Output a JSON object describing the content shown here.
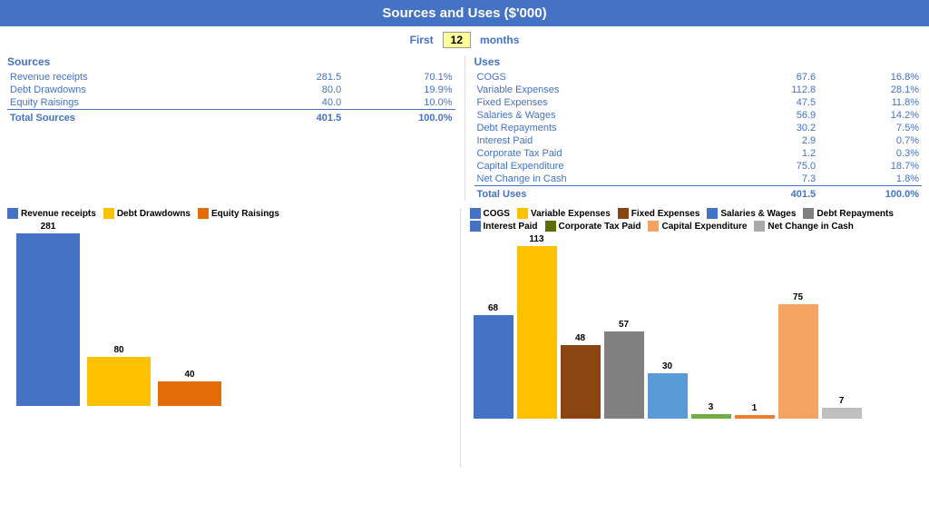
{
  "header": {
    "title": "Sources and Uses ($'000)"
  },
  "months_row": {
    "label_first": "First",
    "months_value": "12",
    "label_months": "months"
  },
  "sources": {
    "title": "Sources",
    "items": [
      {
        "label": "Revenue receipts",
        "value": "281.5",
        "pct": "70.1%"
      },
      {
        "label": "Debt Drawdowns",
        "value": "80.0",
        "pct": "19.9%"
      },
      {
        "label": "Equity Raisings",
        "value": "40.0",
        "pct": "10.0%"
      }
    ],
    "total_label": "Total Sources",
    "total_value": "401.5",
    "total_pct": "100.0%"
  },
  "uses": {
    "title": "Uses",
    "items": [
      {
        "label": "COGS",
        "value": "67.6",
        "pct": "16.8%"
      },
      {
        "label": "Variable Expenses",
        "value": "112.8",
        "pct": "28.1%"
      },
      {
        "label": "Fixed Expenses",
        "value": "47.5",
        "pct": "11.8%"
      },
      {
        "label": "Salaries & Wages",
        "value": "56.9",
        "pct": "14.2%"
      },
      {
        "label": "Debt Repayments",
        "value": "30.2",
        "pct": "7.5%"
      },
      {
        "label": "Interest Paid",
        "value": "2.9",
        "pct": "0.7%"
      },
      {
        "label": "Corporate Tax Paid",
        "value": "1.2",
        "pct": "0.3%"
      },
      {
        "label": "Capital Expenditure",
        "value": "75.0",
        "pct": "18.7%"
      },
      {
        "label": "Net Change in Cash",
        "value": "7.3",
        "pct": "1.8%"
      }
    ],
    "total_label": "Total Uses",
    "total_value": "401.5",
    "total_pct": "100.0%"
  },
  "left_legend": [
    {
      "label": "Revenue receipts",
      "color": "#4472C4"
    },
    {
      "label": "Debt Drawdowns",
      "color": "#FFC000"
    },
    {
      "label": "Equity Raisings",
      "color": "#E36C09"
    }
  ],
  "right_legend": [
    {
      "label": "COGS",
      "color": "#4472C4"
    },
    {
      "label": "Variable Expenses",
      "color": "#FFC000"
    },
    {
      "label": "Fixed Expenses",
      "color": "#7F4C00"
    },
    {
      "label": "Salaries & Wages",
      "color": "#4472C4"
    },
    {
      "label": "Debt Repayments",
      "color": "#808080"
    },
    {
      "label": "Interest Paid",
      "color": "#4472C4"
    },
    {
      "label": "Corporate Tax Paid",
      "color": "#596E00"
    },
    {
      "label": "Capital Expenditure",
      "color": "#F4A460"
    },
    {
      "label": "Net Change in Cash",
      "color": "#AAAAAA"
    }
  ],
  "left_bars": [
    {
      "label": "281",
      "value": 281,
      "color": "#4472C4",
      "pct": 100
    },
    {
      "label": "80",
      "value": 80,
      "color": "#FFC000",
      "pct": 28.5
    },
    {
      "label": "40",
      "value": 40,
      "color": "#E36C09",
      "pct": 14.2
    }
  ],
  "right_bars": [
    {
      "label": "68",
      "value": 68,
      "color": "#4472C4"
    },
    {
      "label": "113",
      "value": 113,
      "color": "#FFC000"
    },
    {
      "label": "48",
      "value": 48,
      "color": "#8B4513"
    },
    {
      "label": "57",
      "value": 57,
      "color": "#808080"
    },
    {
      "label": "30",
      "value": 30,
      "color": "#5B9BD5"
    },
    {
      "label": "3",
      "value": 3,
      "color": "#70AD47"
    },
    {
      "label": "1",
      "value": 1,
      "color": "#ED7D31"
    },
    {
      "label": "75",
      "value": 75,
      "color": "#F4A460"
    },
    {
      "label": "7",
      "value": 7,
      "color": "#BFBFBF"
    }
  ]
}
